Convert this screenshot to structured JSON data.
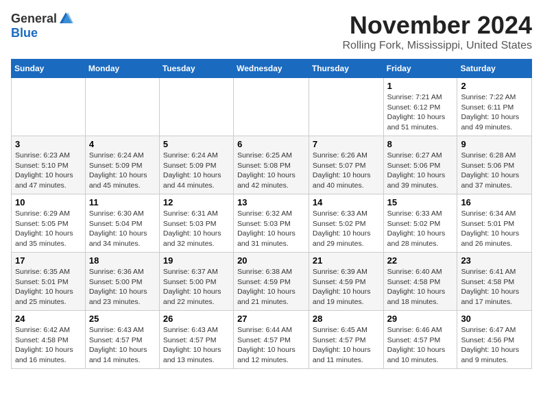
{
  "logo": {
    "general": "General",
    "blue": "Blue"
  },
  "title": "November 2024",
  "location": "Rolling Fork, Mississippi, United States",
  "weekdays": [
    "Sunday",
    "Monday",
    "Tuesday",
    "Wednesday",
    "Thursday",
    "Friday",
    "Saturday"
  ],
  "weeks": [
    [
      {
        "day": "",
        "info": ""
      },
      {
        "day": "",
        "info": ""
      },
      {
        "day": "",
        "info": ""
      },
      {
        "day": "",
        "info": ""
      },
      {
        "day": "",
        "info": ""
      },
      {
        "day": "1",
        "info": "Sunrise: 7:21 AM\nSunset: 6:12 PM\nDaylight: 10 hours\nand 51 minutes."
      },
      {
        "day": "2",
        "info": "Sunrise: 7:22 AM\nSunset: 6:11 PM\nDaylight: 10 hours\nand 49 minutes."
      }
    ],
    [
      {
        "day": "3",
        "info": "Sunrise: 6:23 AM\nSunset: 5:10 PM\nDaylight: 10 hours\nand 47 minutes."
      },
      {
        "day": "4",
        "info": "Sunrise: 6:24 AM\nSunset: 5:09 PM\nDaylight: 10 hours\nand 45 minutes."
      },
      {
        "day": "5",
        "info": "Sunrise: 6:24 AM\nSunset: 5:09 PM\nDaylight: 10 hours\nand 44 minutes."
      },
      {
        "day": "6",
        "info": "Sunrise: 6:25 AM\nSunset: 5:08 PM\nDaylight: 10 hours\nand 42 minutes."
      },
      {
        "day": "7",
        "info": "Sunrise: 6:26 AM\nSunset: 5:07 PM\nDaylight: 10 hours\nand 40 minutes."
      },
      {
        "day": "8",
        "info": "Sunrise: 6:27 AM\nSunset: 5:06 PM\nDaylight: 10 hours\nand 39 minutes."
      },
      {
        "day": "9",
        "info": "Sunrise: 6:28 AM\nSunset: 5:06 PM\nDaylight: 10 hours\nand 37 minutes."
      }
    ],
    [
      {
        "day": "10",
        "info": "Sunrise: 6:29 AM\nSunset: 5:05 PM\nDaylight: 10 hours\nand 35 minutes."
      },
      {
        "day": "11",
        "info": "Sunrise: 6:30 AM\nSunset: 5:04 PM\nDaylight: 10 hours\nand 34 minutes."
      },
      {
        "day": "12",
        "info": "Sunrise: 6:31 AM\nSunset: 5:03 PM\nDaylight: 10 hours\nand 32 minutes."
      },
      {
        "day": "13",
        "info": "Sunrise: 6:32 AM\nSunset: 5:03 PM\nDaylight: 10 hours\nand 31 minutes."
      },
      {
        "day": "14",
        "info": "Sunrise: 6:33 AM\nSunset: 5:02 PM\nDaylight: 10 hours\nand 29 minutes."
      },
      {
        "day": "15",
        "info": "Sunrise: 6:33 AM\nSunset: 5:02 PM\nDaylight: 10 hours\nand 28 minutes."
      },
      {
        "day": "16",
        "info": "Sunrise: 6:34 AM\nSunset: 5:01 PM\nDaylight: 10 hours\nand 26 minutes."
      }
    ],
    [
      {
        "day": "17",
        "info": "Sunrise: 6:35 AM\nSunset: 5:01 PM\nDaylight: 10 hours\nand 25 minutes."
      },
      {
        "day": "18",
        "info": "Sunrise: 6:36 AM\nSunset: 5:00 PM\nDaylight: 10 hours\nand 23 minutes."
      },
      {
        "day": "19",
        "info": "Sunrise: 6:37 AM\nSunset: 5:00 PM\nDaylight: 10 hours\nand 22 minutes."
      },
      {
        "day": "20",
        "info": "Sunrise: 6:38 AM\nSunset: 4:59 PM\nDaylight: 10 hours\nand 21 minutes."
      },
      {
        "day": "21",
        "info": "Sunrise: 6:39 AM\nSunset: 4:59 PM\nDaylight: 10 hours\nand 19 minutes."
      },
      {
        "day": "22",
        "info": "Sunrise: 6:40 AM\nSunset: 4:58 PM\nDaylight: 10 hours\nand 18 minutes."
      },
      {
        "day": "23",
        "info": "Sunrise: 6:41 AM\nSunset: 4:58 PM\nDaylight: 10 hours\nand 17 minutes."
      }
    ],
    [
      {
        "day": "24",
        "info": "Sunrise: 6:42 AM\nSunset: 4:58 PM\nDaylight: 10 hours\nand 16 minutes."
      },
      {
        "day": "25",
        "info": "Sunrise: 6:43 AM\nSunset: 4:57 PM\nDaylight: 10 hours\nand 14 minutes."
      },
      {
        "day": "26",
        "info": "Sunrise: 6:43 AM\nSunset: 4:57 PM\nDaylight: 10 hours\nand 13 minutes."
      },
      {
        "day": "27",
        "info": "Sunrise: 6:44 AM\nSunset: 4:57 PM\nDaylight: 10 hours\nand 12 minutes."
      },
      {
        "day": "28",
        "info": "Sunrise: 6:45 AM\nSunset: 4:57 PM\nDaylight: 10 hours\nand 11 minutes."
      },
      {
        "day": "29",
        "info": "Sunrise: 6:46 AM\nSunset: 4:57 PM\nDaylight: 10 hours\nand 10 minutes."
      },
      {
        "day": "30",
        "info": "Sunrise: 6:47 AM\nSunset: 4:56 PM\nDaylight: 10 hours\nand 9 minutes."
      }
    ]
  ]
}
